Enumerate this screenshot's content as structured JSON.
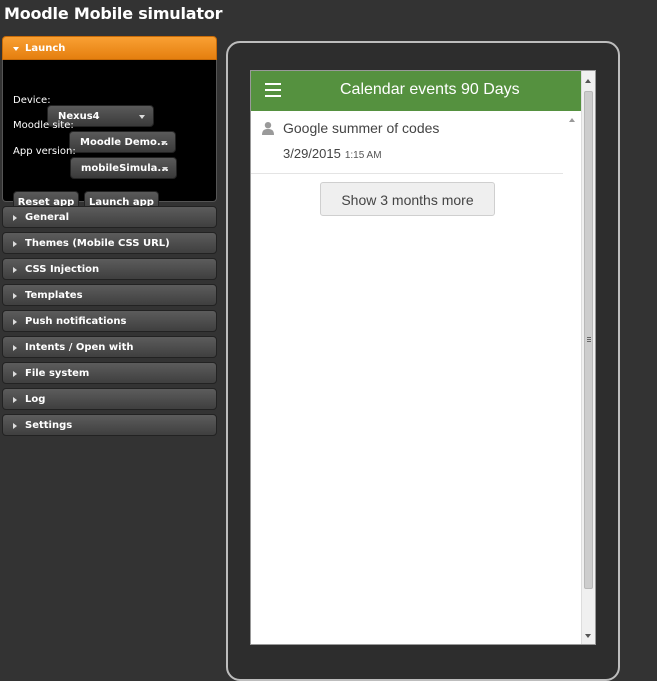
{
  "app": {
    "title": "Moodle Mobile simulator"
  },
  "launch": {
    "header": "Launch",
    "device_label": "Device:",
    "device_value": "Nexus4",
    "site_label": "Moodle site:",
    "site_value": "Moodle Demo...",
    "version_label": "App version:",
    "version_value": "mobileSimula...",
    "reset_label": "Reset app",
    "launch_label": "Launch app"
  },
  "sections": [
    {
      "label": "General"
    },
    {
      "label": "Themes (Mobile CSS URL)"
    },
    {
      "label": "CSS Injection"
    },
    {
      "label": "Templates"
    },
    {
      "label": "Push notifications"
    },
    {
      "label": "Intents / Open with"
    },
    {
      "label": "File system"
    },
    {
      "label": "Log"
    },
    {
      "label": "Settings"
    }
  ],
  "mobile": {
    "title": "Calendar events 90 Days",
    "event": {
      "name": "Google summer of codes",
      "date": "3/29/2015",
      "time": "1:15 AM"
    },
    "more_button": "Show 3 months more"
  },
  "colors": {
    "accent": "#f39322",
    "topbar": "#55913f"
  },
  "icons": [
    "menu-icon",
    "user-icon",
    "expand-arrow-icon",
    "collapse-arrow-icon",
    "dropdown-caret-icon"
  ]
}
